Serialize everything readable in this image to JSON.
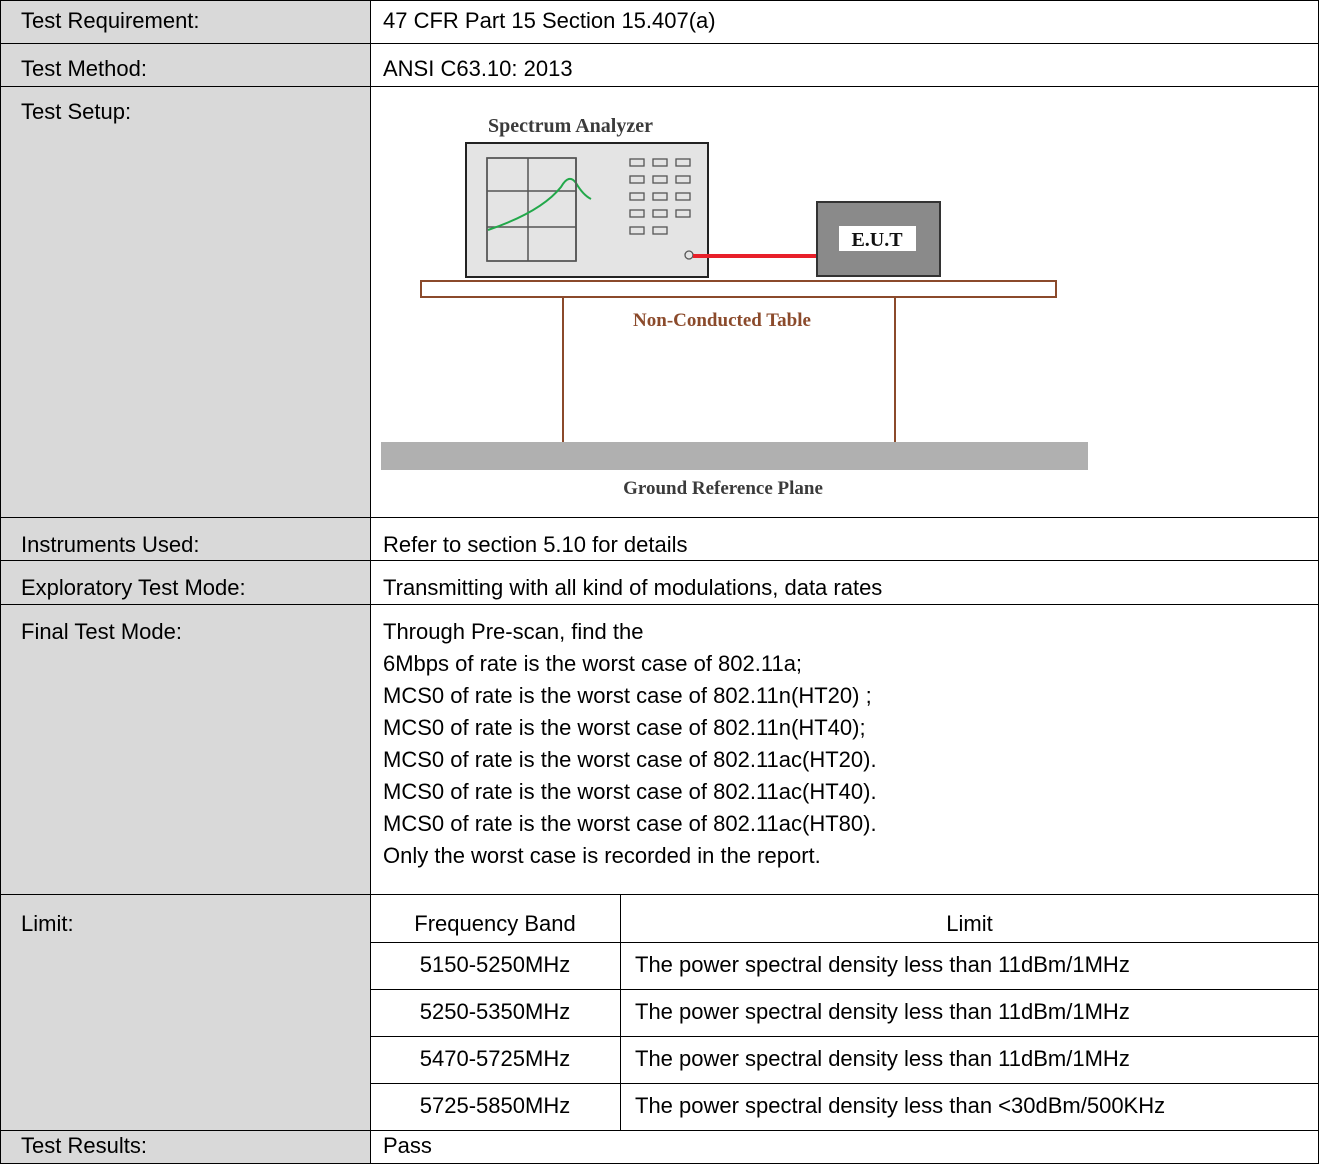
{
  "rows": {
    "requirement": {
      "label": "Test Requirement:",
      "value": "47 CFR Part 15 Section 15.407(a)"
    },
    "method": {
      "label": "Test Method:",
      "value": "ANSI C63.10: 2013"
    },
    "setup": {
      "label": "Test Setup:"
    },
    "instruments": {
      "label": "Instruments Used:",
      "value": "Refer to section 5.10 for details"
    },
    "exploratory": {
      "label": "Exploratory Test Mode:",
      "value": "Transmitting with all kind of modulations, data rates"
    },
    "final_mode": {
      "label": "Final Test Mode:",
      "lines": [
        "Through Pre-scan, find the",
        "6Mbps of rate is the worst case of 802.11a;",
        "MCS0 of rate is the worst case of 802.11n(HT20) ;",
        "MCS0 of rate is the worst case of 802.11n(HT40);",
        "MCS0 of rate is the worst case of 802.11ac(HT20).",
        "MCS0 of rate is the worst case of 802.11ac(HT40).",
        "MCS0 of rate is the worst case of 802.11ac(HT80).",
        "Only the worst case is recorded in the report."
      ]
    },
    "limit": {
      "label": "Limit:",
      "headers": [
        "Frequency Band",
        "Limit"
      ],
      "rows": [
        [
          "5150-5250MHz",
          "The power spectral density less than 11dBm/1MHz"
        ],
        [
          "5250-5350MHz",
          "The power spectral density less than 11dBm/1MHz"
        ],
        [
          "5470-5725MHz",
          "The power spectral density less than 11dBm/1MHz"
        ],
        [
          "5725-5850MHz",
          "The power spectral density less than <30dBm/500KHz"
        ]
      ]
    },
    "results": {
      "label": "Test Results:",
      "value": "Pass"
    }
  },
  "diagram": {
    "analyzer_label": "Spectrum Analyzer",
    "eut_label": "E.U.T",
    "table_label": "Non-Conducted Table",
    "ground_label": "Ground Reference Plane"
  },
  "colors": {
    "label_bg": "#d9d9d9",
    "trace": "#22a84a",
    "cable": "#e8202a",
    "table_brown": "#8b4a2b",
    "ground": "#b0b0b0"
  }
}
